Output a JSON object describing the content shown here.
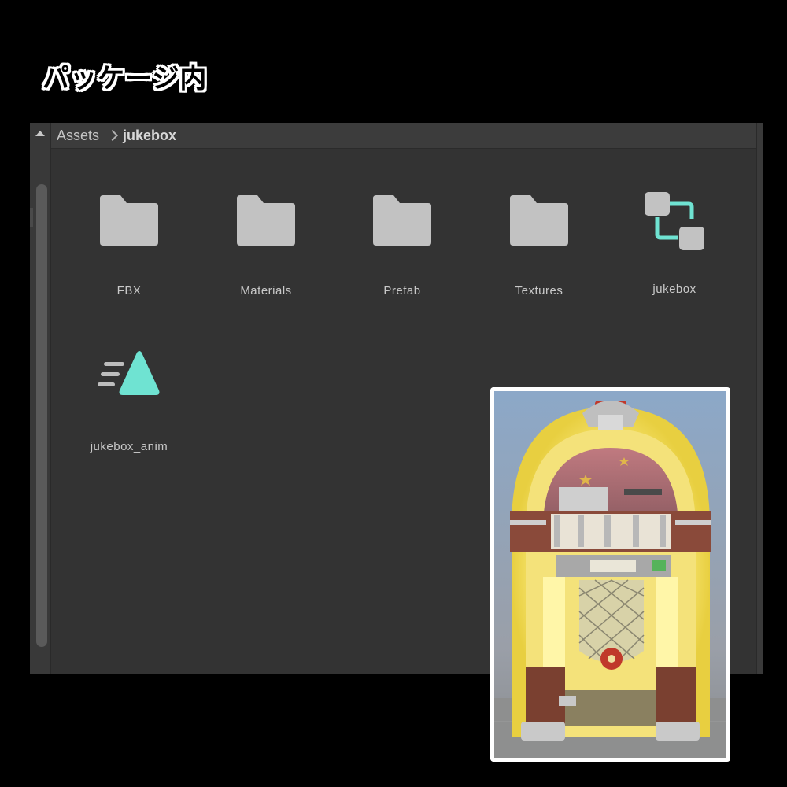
{
  "heading": "パッケージ内",
  "breadcrumb": {
    "root": "Assets",
    "current": "jukebox"
  },
  "items": [
    {
      "label": "FBX",
      "icon": "folder-icon"
    },
    {
      "label": "Materials",
      "icon": "folder-icon"
    },
    {
      "label": "Prefab",
      "icon": "folder-icon"
    },
    {
      "label": "Textures",
      "icon": "folder-icon"
    },
    {
      "label": "jukebox",
      "icon": "prefab-variant-icon"
    },
    {
      "label": "jukebox_anim",
      "icon": "animation-clip-icon"
    }
  ],
  "colors": {
    "panel_bg": "#333333",
    "folder": "#c2c2c2",
    "accent_teal": "#6fe3d2",
    "glow_yellow": "#fff28a"
  }
}
